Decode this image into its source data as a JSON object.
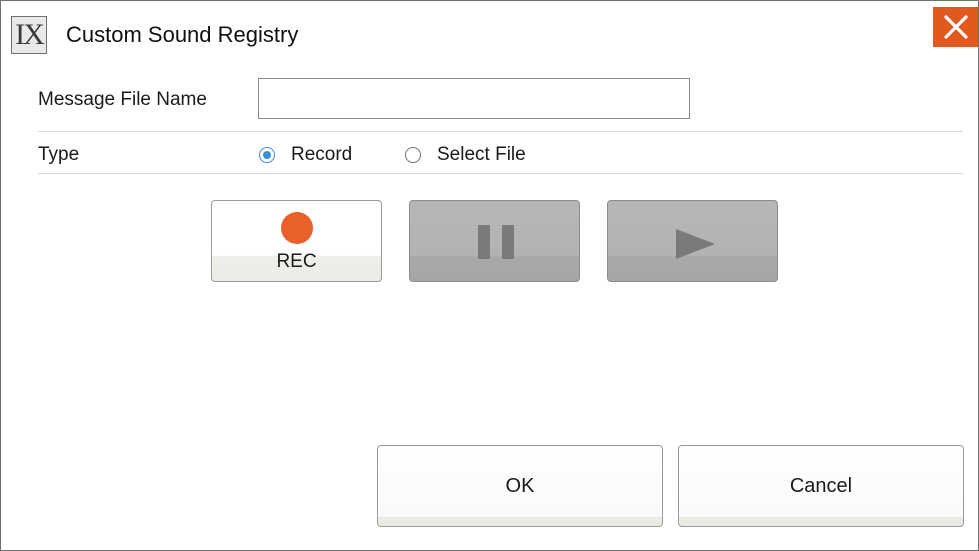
{
  "window": {
    "title": "Custom Sound Registry",
    "logo_text": "IX",
    "close_icon": "close-icon",
    "accent_color": "#e05a1e"
  },
  "form": {
    "message_file_name_label": "Message File Name",
    "message_file_name_value": "",
    "type_label": "Type",
    "type_options": [
      {
        "label": "Record",
        "checked": true
      },
      {
        "label": "Select File",
        "checked": false
      }
    ]
  },
  "media": {
    "rec_label": "REC",
    "rec_color": "#e8602a",
    "pause_icon": "pause-icon",
    "pause_enabled": false,
    "play_icon": "play-icon",
    "play_enabled": false
  },
  "buttons": {
    "ok_label": "OK",
    "cancel_label": "Cancel"
  }
}
